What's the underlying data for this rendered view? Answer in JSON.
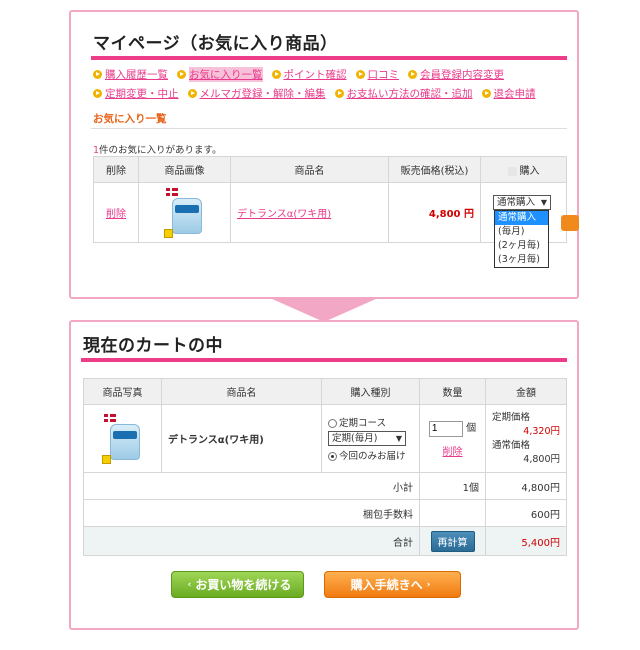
{
  "mypage": {
    "title": "マイページ（お気に入り商品）",
    "nav_row1": [
      {
        "label": "購入履歴一覧",
        "active": false
      },
      {
        "label": "お気に入り一覧",
        "active": true
      },
      {
        "label": "ポイント確認",
        "active": false
      },
      {
        "label": "口コミ",
        "active": false
      },
      {
        "label": "会員登録内容変更",
        "active": false
      }
    ],
    "nav_row2": [
      {
        "label": "定期変更・中止",
        "active": false
      },
      {
        "label": "メルマガ登録・解除・編集",
        "active": false
      },
      {
        "label": "お支払い方法の確認・追加",
        "active": false
      },
      {
        "label": "退会申請",
        "active": false
      }
    ],
    "section_title": "お気に入り一覧",
    "count_num": "1",
    "count_text": "件のお気に入りがあります。",
    "table": {
      "headers": [
        "削除",
        "商品画像",
        "商品名",
        "販売価格(税込)",
        "購入"
      ],
      "row": {
        "delete": "削除",
        "name": "デトランスα(ワキ用)",
        "price": "4,800 円",
        "select_value": "通常購入",
        "options": [
          "通常購入",
          "(毎月)",
          "(2ヶ月毎)",
          "(3ヶ月毎)"
        ]
      }
    }
  },
  "cart": {
    "title": "現在のカートの中",
    "headers": [
      "商品写真",
      "商品名",
      "購入種別",
      "数量",
      "金額"
    ],
    "row": {
      "name": "デトランスα(ワキ用)",
      "teiki_label": "定期コース",
      "teiki_select": "定期(毎月)",
      "once_label": "今回のみお届け",
      "qty": "1",
      "qty_unit": "個",
      "delete": "削除",
      "teiki_price_label": "定期価格",
      "teiki_price": "4,320円",
      "normal_price_label": "通常価格",
      "normal_price": "4,800円"
    },
    "subtotal_label": "小計",
    "subtotal_qty": "1個",
    "subtotal_amount": "4,800円",
    "wrap_label": "梱包手数料",
    "wrap_amount": "600円",
    "total_label": "合計",
    "recalc": "再計算",
    "total_amount": "5,400円"
  },
  "buttons": {
    "continue": "お買い物を続ける",
    "checkout": "購入手続きへ"
  },
  "colors": {
    "pink_border": "#f2a7c4",
    "pink_accent": "#ee3d88",
    "link": "#e83a8a",
    "price_red": "#d10000"
  }
}
